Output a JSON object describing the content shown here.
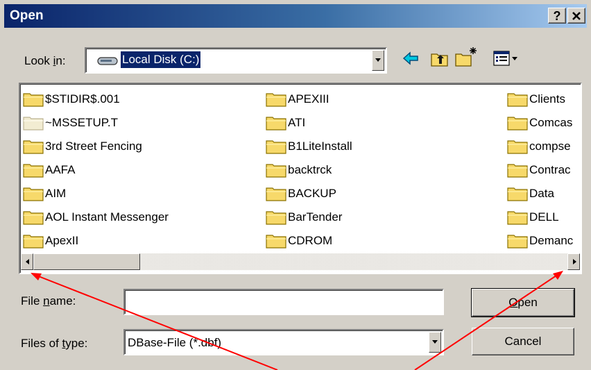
{
  "dialog": {
    "title": "Open",
    "help_label": "?",
    "close_label": "✕"
  },
  "look_in": {
    "label_pre": "Look ",
    "label_key": "i",
    "label_post": "n:",
    "value": "Local Disk (C:)"
  },
  "files": [
    {
      "name": "$STIDIR$.001"
    },
    {
      "name": "~MSSETUP.T"
    },
    {
      "name": "3rd Street Fencing"
    },
    {
      "name": "AAFA"
    },
    {
      "name": "AIM"
    },
    {
      "name": "AOL Instant Messenger"
    },
    {
      "name": "ApexII"
    },
    {
      "name": "APEXIII"
    },
    {
      "name": "ATI"
    },
    {
      "name": "B1LiteInstall"
    },
    {
      "name": "backtrck"
    },
    {
      "name": "BACKUP"
    },
    {
      "name": "BarTender"
    },
    {
      "name": "CDROM"
    },
    {
      "name": "Clients"
    },
    {
      "name": "Comcas"
    },
    {
      "name": "compse"
    },
    {
      "name": "Contrac"
    },
    {
      "name": "Data"
    },
    {
      "name": "DELL"
    },
    {
      "name": "Demanc"
    }
  ],
  "file_name": {
    "label_pre": "File ",
    "label_key": "n",
    "label_post": "ame:",
    "value": ""
  },
  "file_type": {
    "label_pre": "Files of ",
    "label_key": "t",
    "label_post": "ype:",
    "value": "DBase-File (*.dbf)"
  },
  "buttons": {
    "open_key": "O",
    "open_rest": "pen",
    "cancel": "Cancel"
  },
  "colors": {
    "title_gradient_start": "#0a246a",
    "title_gradient_end": "#a6caf0",
    "selection": "#0a246a",
    "annotation_arrow": "#ff0000",
    "folder": "#f7d96a"
  }
}
